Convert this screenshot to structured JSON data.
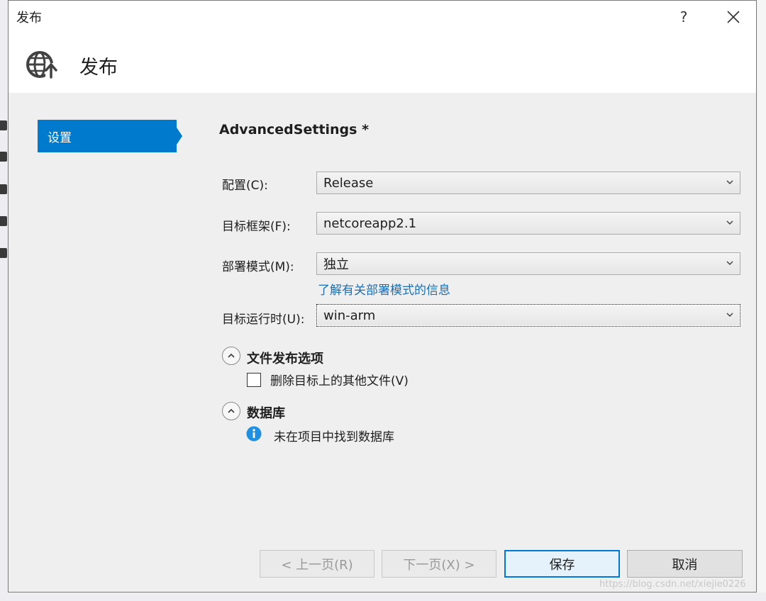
{
  "window": {
    "title": "发布",
    "help_label": "?",
    "close_label": "✕"
  },
  "header": {
    "title": "发布",
    "icon": "globe-upload-icon"
  },
  "sidebar": {
    "items": [
      {
        "label": "设置"
      }
    ]
  },
  "settings": {
    "title": "AdvancedSettings *",
    "fields": [
      {
        "label": "配置(C):",
        "value": "Release"
      },
      {
        "label": "目标框架(F):",
        "value": "netcoreapp2.1"
      },
      {
        "label": "部署模式(M):",
        "value": "独立"
      },
      {
        "label": "目标运行时(U):",
        "value": "win-arm"
      }
    ],
    "deployment_link": "了解有关部署模式的信息"
  },
  "file_publish": {
    "title": "文件发布选项",
    "checkbox_label": "删除目标上的其他文件(V)",
    "checked": false
  },
  "database": {
    "title": "数据库",
    "info_text": "未在项目中找到数据库"
  },
  "buttons": {
    "prev": "< 上一页(R)",
    "next": "下一页(X) >",
    "save": "保存",
    "cancel": "取消"
  },
  "watermark": "https://blog.csdn.net/xiejie0226",
  "colors": {
    "accent": "#007acc",
    "link": "#1a6fb5",
    "info": "#1e8fe1"
  }
}
